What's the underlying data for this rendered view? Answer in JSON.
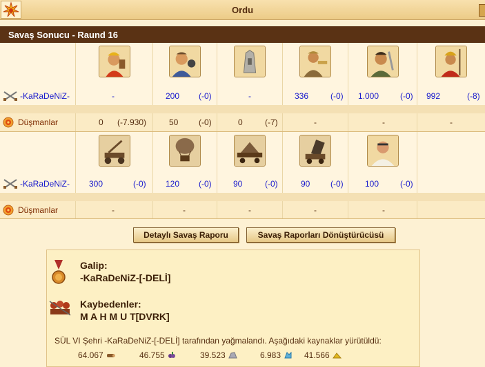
{
  "window": {
    "title": "Ordu"
  },
  "report": {
    "heading": "Savaş Sonucu - Raund 16"
  },
  "block1": {
    "units": [
      "hoplite-icon",
      "slinger-icon",
      "wall-icon",
      "archer-icon",
      "swordsman-icon",
      "spearman-icon"
    ],
    "player": {
      "name": "-KaRaDeNiZ-",
      "cells": [
        [
          "-",
          ""
        ],
        [
          "200",
          "(-0)"
        ],
        [
          "-",
          ""
        ],
        [
          "336",
          "(-0)"
        ],
        [
          "1.000",
          "(-0)"
        ],
        [
          "992",
          "(-8)"
        ]
      ]
    },
    "enemy": {
      "name": "Düşmanlar",
      "cells": [
        [
          "0",
          "(-7.930)"
        ],
        [
          "50",
          "(-0)"
        ],
        [
          "0",
          "(-7)"
        ],
        [
          "-",
          ""
        ],
        [
          "-",
          ""
        ],
        [
          "-",
          ""
        ]
      ]
    }
  },
  "block2": {
    "units": [
      "catapult-icon",
      "balloon-icon",
      "ram-icon",
      "mortar-icon",
      "doctor-icon"
    ],
    "player": {
      "name": "-KaRaDeNiZ-",
      "cells": [
        [
          "300",
          "(-0)"
        ],
        [
          "120",
          "(-0)"
        ],
        [
          "90",
          "(-0)"
        ],
        [
          "90",
          "(-0)"
        ],
        [
          "100",
          "(-0)"
        ]
      ]
    },
    "enemy": {
      "name": "Düşmanlar",
      "cells": [
        [
          "-",
          ""
        ],
        [
          "-",
          ""
        ],
        [
          "-",
          ""
        ],
        [
          "-",
          ""
        ],
        [
          "-",
          ""
        ]
      ]
    }
  },
  "buttons": {
    "detailed": "Detaylı Savaş Raporu",
    "converter": "Savaş Raporları Dönüştürücüsü"
  },
  "result": {
    "winner_label": "Galip:",
    "winner": "-KaRaDeNiZ-[-DELİ]",
    "losers_label": "Kaybedenler:",
    "loser": "M A H M U T[DVRK]",
    "plunder": "SÜL VI Şehri -KaRaDeNiZ-[-DELİ] tarafından yağmalandı. Aşağıdaki kaynaklar yürütüldü:",
    "resources": [
      {
        "amount": "64.067",
        "icon": "wood-icon",
        "color": "#8a5a2a"
      },
      {
        "amount": "46.755",
        "icon": "wine-icon",
        "color": "#6a3a8a"
      },
      {
        "amount": "39.523",
        "icon": "marble-icon",
        "color": "#a9a9b4"
      },
      {
        "amount": "6.983",
        "icon": "crystal-icon",
        "color": "#5fb0d8"
      },
      {
        "amount": "41.566",
        "icon": "sulfur-icon",
        "color": "#e0b820"
      }
    ]
  }
}
